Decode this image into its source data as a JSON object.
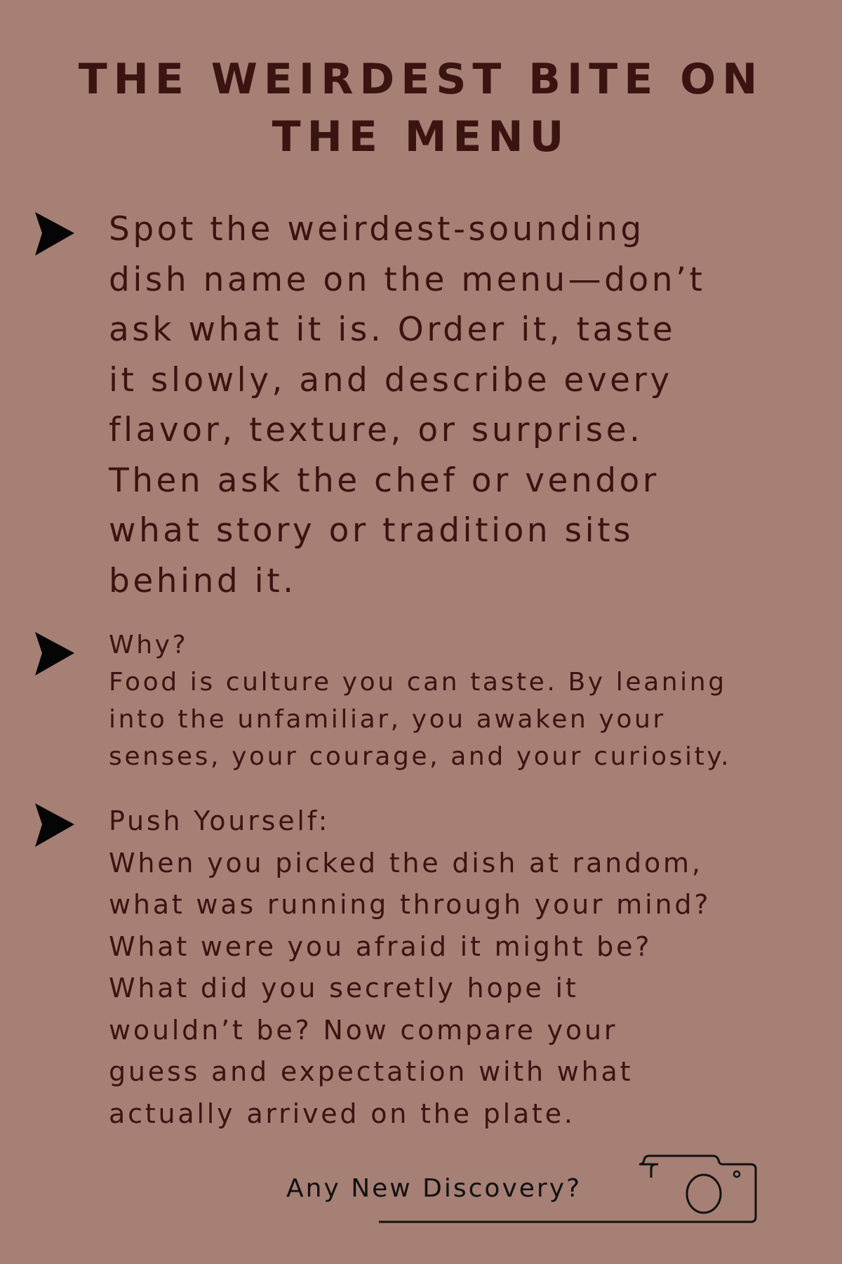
{
  "title_lines": [
    "THE WEIRDEST BITE ON",
    "THE MENU"
  ],
  "challenge_lines": [
    "Spot the weirdest-sounding",
    "dish name on the menu—don’t",
    "ask what it is. Order it, taste",
    "it slowly, and describe every",
    "flavor, texture, or surprise.",
    "Then ask the chef or vendor",
    "what story or tradition sits",
    "behind it."
  ],
  "why": {
    "heading": "Why?",
    "lines": [
      "Food is culture you can taste. By leaning",
      "into the unfamiliar, you awaken your",
      "senses, your courage, and your curiosity."
    ]
  },
  "push": {
    "heading": "Push Yourself:",
    "lines": [
      "When you picked the dish at random,",
      "what was running through your mind?",
      "What were you afraid it might be?",
      "What did you secretly hope it",
      "wouldn’t be? Now compare your",
      "guess and expectation with what",
      "actually arrived on the plate."
    ]
  },
  "discovery_label": "Any New Discovery?",
  "icons": {
    "bullet": "arrowhead-icon",
    "photo": "camera-icon"
  },
  "colors": {
    "background": "#a67f75",
    "text": "#3a1410",
    "bullet": "#050505"
  }
}
